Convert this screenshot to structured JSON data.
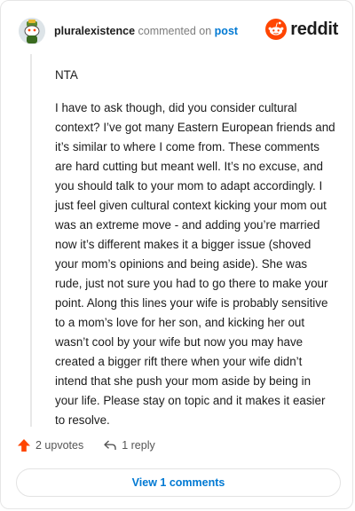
{
  "header": {
    "username": "pluralexistence",
    "commented_on": "commented on",
    "post_link": "post",
    "brand": "reddit"
  },
  "comment": {
    "paragraphs": [
      "NTA",
      "I have to ask though, did you consider cultural context? I’ve got many Eastern European friends and it’s similar to where I come from. These comments are hard cutting but meant well. It’s no excuse, and you should talk to your mom to adapt accordingly. I just feel given cultural context kicking your mom out was an extreme move - and adding you’re married now it’s different makes it a bigger issue (shoved your mom’s opinions and being aside). She was rude, just not sure you had to go there to make your point. Along this lines your wife is probably sensitive to a mom’s love for her son, and kicking her out wasn’t cool by your wife but now you may have created a bigger rift there when your wife didn’t intend that she push your mom aside by being in your life. Please stay on topic and it makes it easier to resolve."
    ]
  },
  "actions": {
    "upvotes": "2 upvotes",
    "reply": "1 reply"
  },
  "view_comments": "View 1 comments",
  "colors": {
    "brand_orange": "#ff4500",
    "link_blue": "#0079d3",
    "upvote_orange": "#ff4500"
  },
  "icons": {
    "avatar": "snoo-avatar",
    "brand": "reddit-logo-icon",
    "upvote": "upvote-arrow-icon",
    "reply": "reply-arrow-icon"
  }
}
